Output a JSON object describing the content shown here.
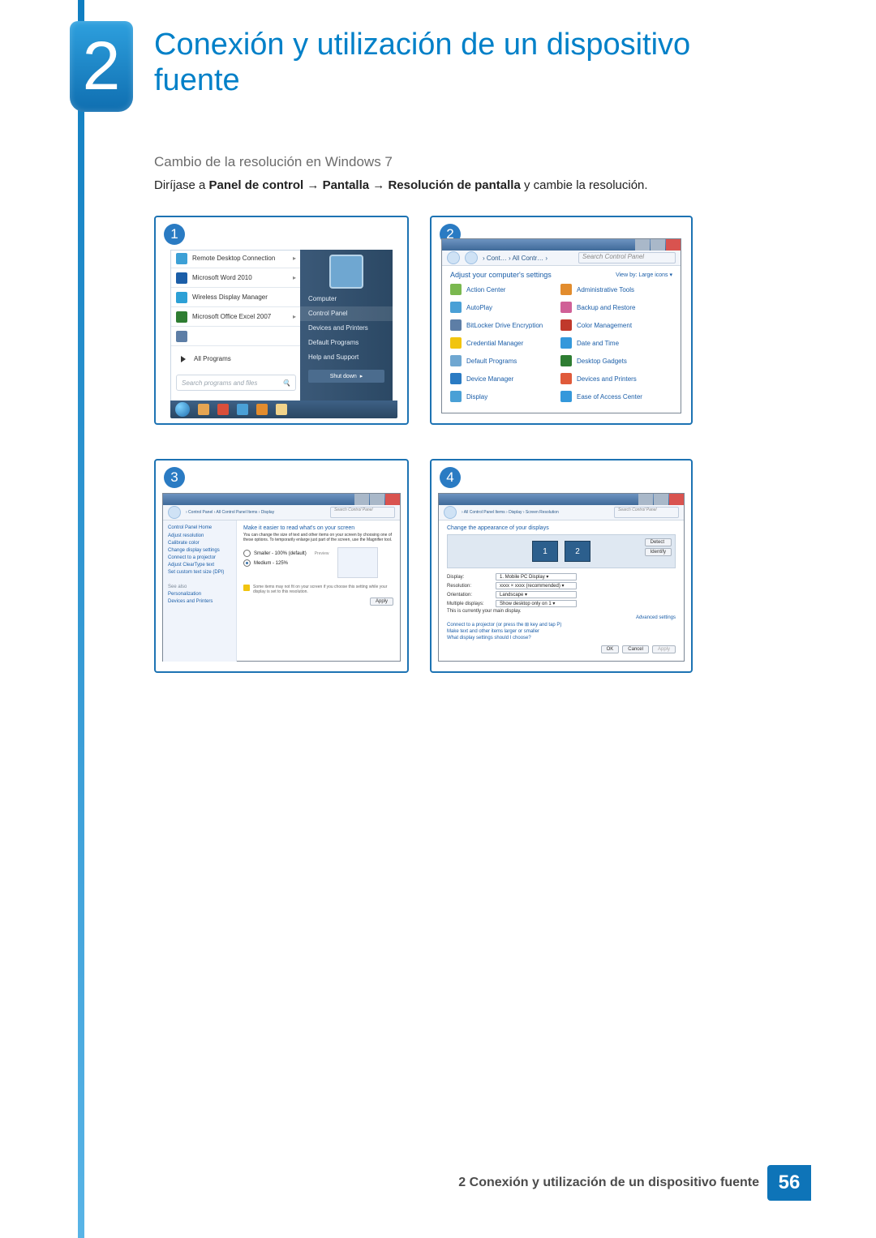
{
  "chapter": {
    "number": "2",
    "title": "Conexión y utilización de un dispositivo fuente"
  },
  "section_heading": "Cambio de la resolución en Windows 7",
  "instruction": {
    "pre": "Diríjase a ",
    "b1": "Panel de control",
    "arrow1": " → ",
    "b2": "Pantalla",
    "arrow2": " → ",
    "b3": "Resolución de pantalla",
    "post": " y cambie la resolución."
  },
  "panel1": {
    "badge": "1",
    "start_items": [
      {
        "label": "Remote Desktop Connection",
        "arrow": "▸"
      },
      {
        "label": "Microsoft Word 2010",
        "arrow": "▸"
      },
      {
        "label": "Wireless Display Manager",
        "arrow": ""
      },
      {
        "label": "Microsoft Office Excel 2007",
        "arrow": "▸"
      }
    ],
    "all_programs": "All Programs",
    "search_placeholder": "Search programs and files",
    "right_items": [
      "Computer",
      "Control Panel",
      "Devices and Printers",
      "Default Programs",
      "Help and Support"
    ],
    "shutdown": "Shut down"
  },
  "panel2": {
    "badge": "2",
    "breadcrumb": "› Cont… › All Contr… ›",
    "search_placeholder": "Search Control Panel",
    "heading": "Adjust your computer's settings",
    "view_by": "View by:   Large icons ▾",
    "items": [
      "Action Center",
      "Administrative Tools",
      "AutoPlay",
      "Backup and Restore",
      "BitLocker Drive Encryption",
      "Color Management",
      "Credential Manager",
      "Date and Time",
      "Default Programs",
      "Desktop Gadgets",
      "Device Manager",
      "Devices and Printers",
      "Display",
      "Ease of Access Center"
    ]
  },
  "panel3": {
    "badge": "3",
    "breadcrumb": "› Control Panel › All Control Panel Items › Display",
    "search_placeholder": "Search Control Panel",
    "left_heading": "Control Panel Home",
    "left_links": [
      "Adjust resolution",
      "Calibrate color",
      "Change display settings",
      "Connect to a projector",
      "Adjust ClearType text",
      "Set custom text size (DPI)"
    ],
    "see_also": "See also",
    "see_links": [
      "Personalization",
      "Devices and Printers"
    ],
    "main_title": "Make it easier to read what's on your screen",
    "main_sub": "You can change the size of text and other items on your screen by choosing one of these options. To temporarily enlarge just part of the screen, use the Magnifier tool.",
    "opt_small": "Smaller - 100% (default)",
    "opt_small_note": "Preview",
    "opt_med": "Medium - 125%",
    "note": "Some items may not fit on your screen if you choose this setting while your display is set to this resolution.",
    "apply": "Apply"
  },
  "panel4": {
    "badge": "4",
    "breadcrumb": "› All Control Panel Items › Display › Screen Resolution",
    "search_placeholder": "Search Control Panel",
    "heading": "Change the appearance of your displays",
    "btn_detect": "Detect",
    "btn_identify": "Identify",
    "mon1": "1",
    "mon2": "2",
    "row_display": {
      "k": "Display:",
      "v": "1. Mobile PC Display ▾"
    },
    "row_res": {
      "k": "Resolution:",
      "v": "xxxx × xxxx   (recommended) ▾"
    },
    "row_orient": {
      "k": "Orientation:",
      "v": "Landscape ▾"
    },
    "row_multi": {
      "k": "Multiple displays:",
      "v": "Show desktop only on 1 ▾"
    },
    "main_note": "This is currently your main display.",
    "advanced": "Advanced settings",
    "link1": "Connect to a projector (or press the ⊞ key and tap P)",
    "link2": "Make text and other items larger or smaller",
    "link3": "What display settings should I choose?",
    "ok": "OK",
    "cancel": "Cancel",
    "apply": "Apply"
  },
  "footer": {
    "text": "2 Conexión y utilización de un dispositivo fuente",
    "page": "56"
  }
}
